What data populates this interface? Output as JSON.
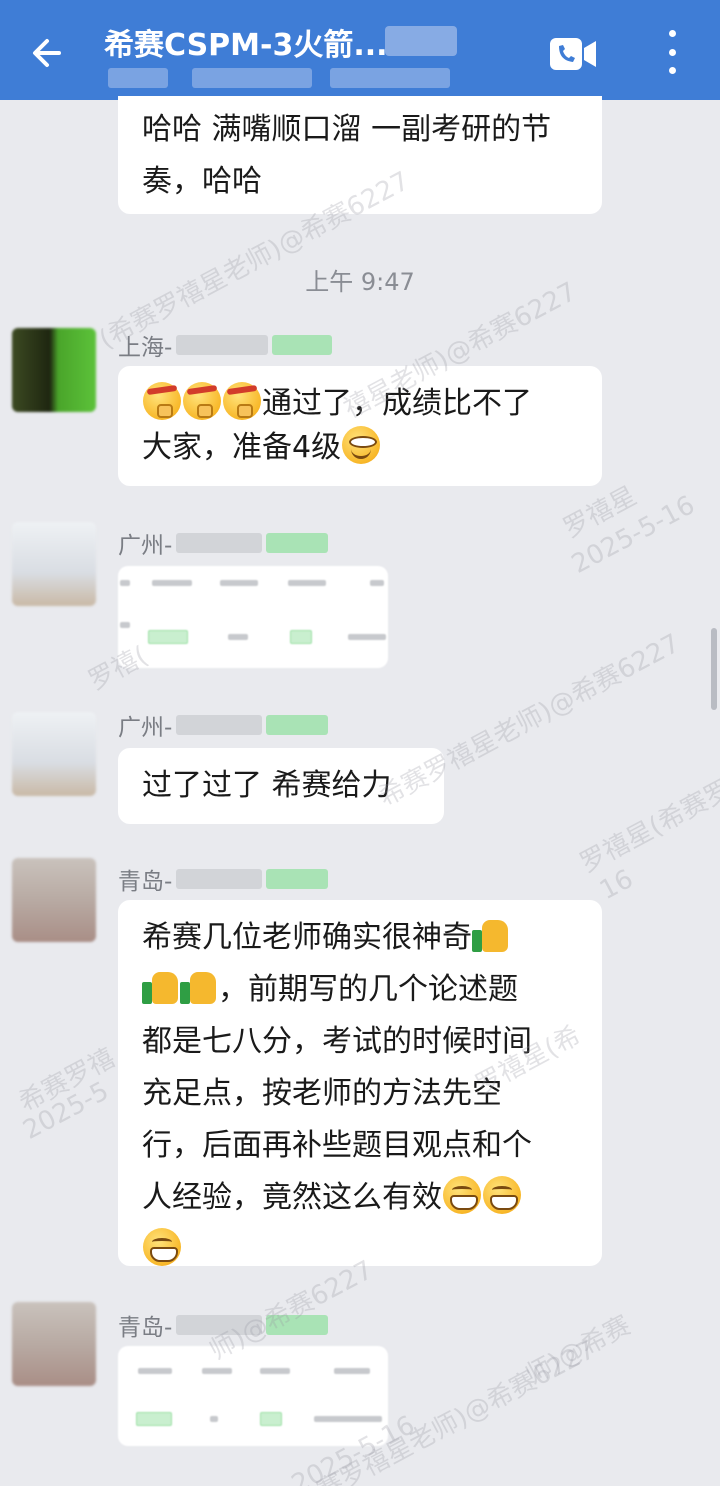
{
  "header": {
    "title": "希赛CSPM-3火箭...",
    "back_icon": "back-arrow-icon",
    "video_icon": "video-call-icon",
    "more_icon": "more-vertical-icon"
  },
  "messages": {
    "m0_text": "哈哈 满嘴顺口溜 一副考研的节奏，哈哈",
    "time": "上午 9:47",
    "m1_sender": "上海-",
    "m1_text_a": "通过了，成绩比不了",
    "m1_text_b": "大家，准备4级",
    "m2_sender": "广州-",
    "m3_sender": "广州-",
    "m3_text": "过了过了  希赛给力",
    "m4_sender": "青岛-",
    "m4_line1": "希赛几位老师确实很神奇",
    "m4_line2": "，前期写的几个论述题",
    "m4_line3": "都是七八分，考试的时候时间",
    "m4_line4": "充足点，按老师的方法先空",
    "m4_line5": "行，后面再补些题目观点和个",
    "m4_line6": "人经验，竟然这么有效",
    "m5_sender": "青岛-"
  },
  "watermarks": {
    "name": "罗禧星(希赛罗禧星老师)@希赛6227",
    "name_short": "罗禧星(希赛罗禧",
    "date": "2025-5-16",
    "wm_a": "(希赛罗禧星老师)@希赛6227",
    "wm_b": "禧星老师)@希赛6227",
    "wm_c": "罗禧星",
    "wm_d": "罗禧(",
    "wm_e": "16",
    "wm_f": "2025-5",
    "wm_g": "罗禧星(希",
    "wm_h": "师)@希赛6227",
    "wm_i": "希赛罗禧星老师)@希赛6227",
    "wm_j": "希赛罗禧",
    "wm_k": "赛罗禧星老师)@希赛6227",
    "wm_l": "罗禧星",
    "wm_m": "2025-5-16",
    "wm_n": "师)@希赛"
  },
  "colors": {
    "header": "#3f7dd6",
    "background": "#e9eaee",
    "bubble": "#ffffff",
    "pill_green": "#9fe0a8"
  }
}
